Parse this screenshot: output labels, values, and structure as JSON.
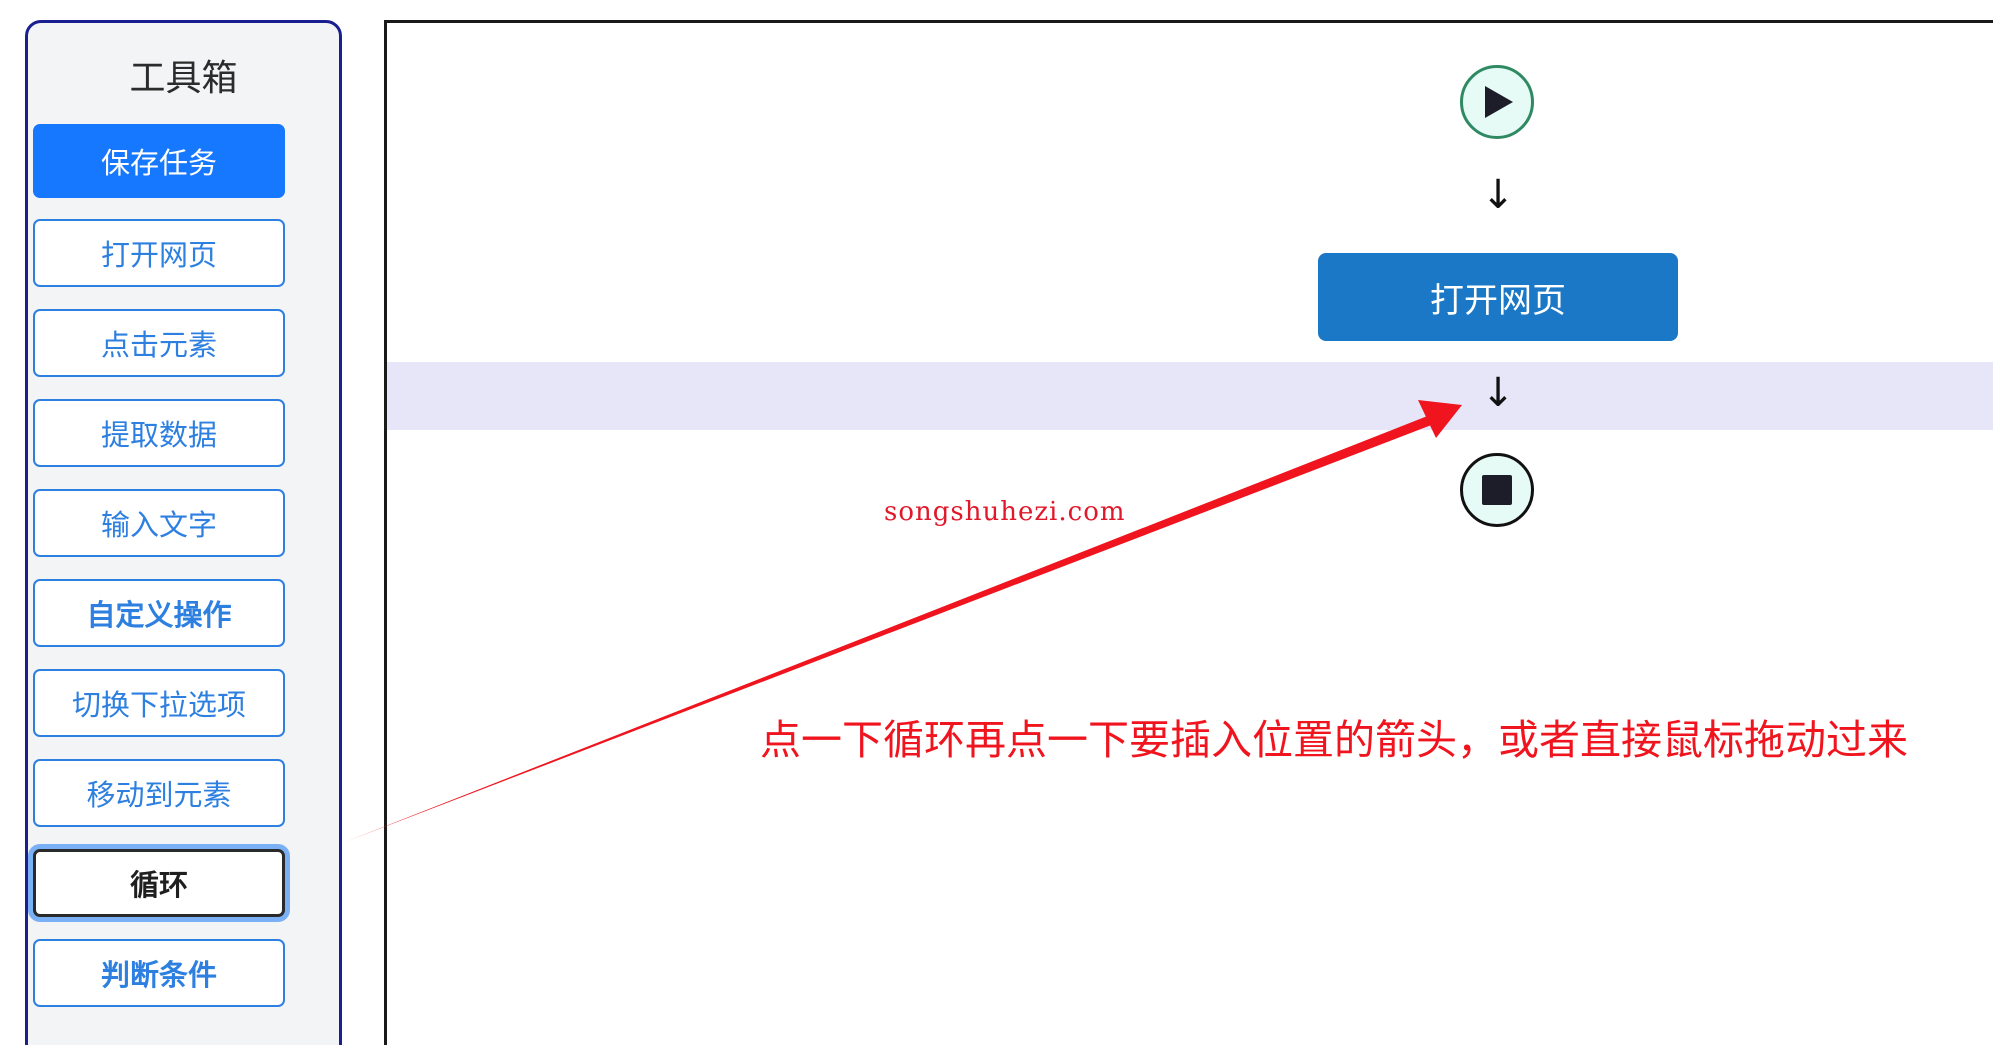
{
  "toolbox": {
    "title": "工具箱",
    "save_label": "保存任务",
    "items": [
      {
        "label": "打开网页"
      },
      {
        "label": "点击元素"
      },
      {
        "label": "提取数据"
      },
      {
        "label": "输入文字"
      },
      {
        "label": "自定义操作"
      },
      {
        "label": "切换下拉选项"
      },
      {
        "label": "移动到元素"
      },
      {
        "label": "循环"
      },
      {
        "label": "判断条件"
      }
    ]
  },
  "flow": {
    "arrow_glyph": "↓",
    "node_label": "打开网页",
    "start_icon": "play-icon",
    "end_icon": "stop-icon"
  },
  "annotation": {
    "watermark": "songshuhezi.com",
    "note": "点一下循环再点一下要插入位置的箭头，或者直接鼠标拖动过来",
    "color": "#f0141e"
  },
  "colors": {
    "primary": "#1677ff",
    "node": "#1b78c6",
    "band": "#e6e6f8"
  }
}
